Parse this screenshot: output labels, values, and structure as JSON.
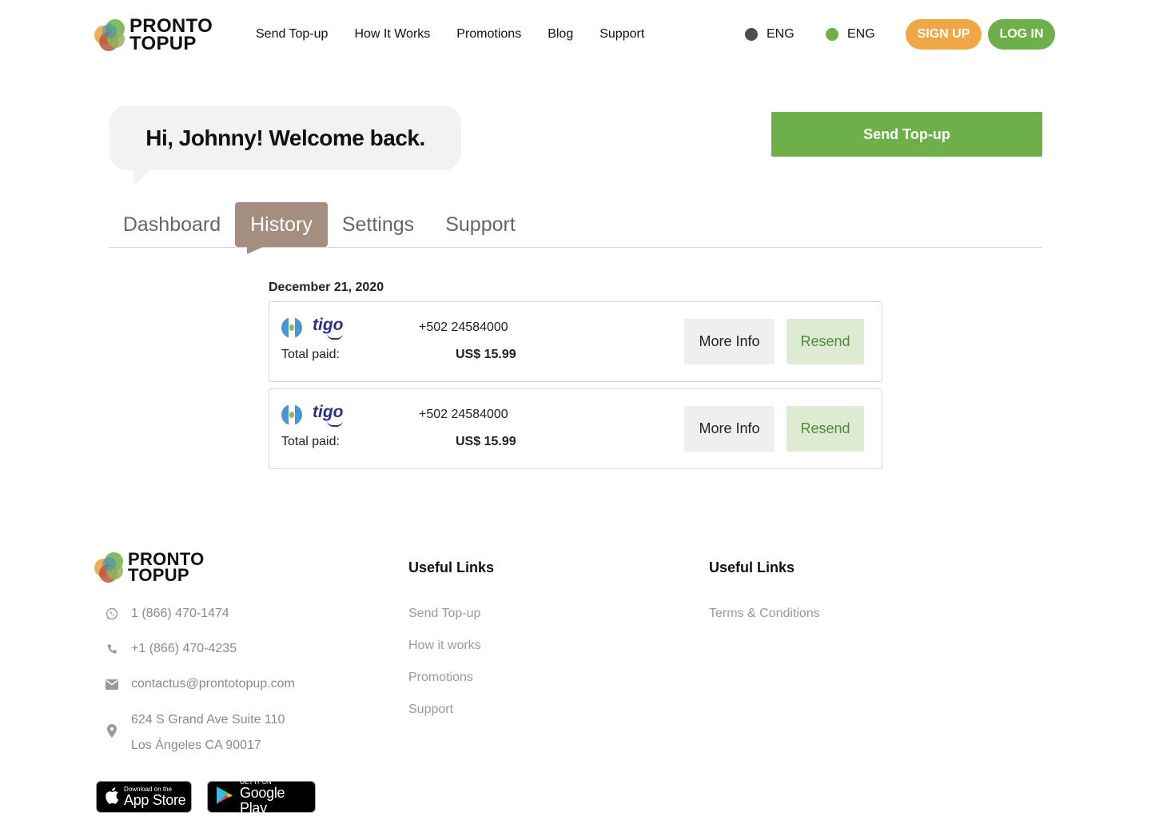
{
  "header": {
    "logo_line1": "PRONTO",
    "logo_line2": "TOPUP",
    "nav": [
      "Send Top-up",
      "How It Works",
      "Promotions",
      "Blog",
      "Support"
    ],
    "languages": [
      {
        "label": "ENG",
        "dot_color": "#4D4D4D"
      },
      {
        "label": "ENG",
        "dot_color": "#6DAF49"
      }
    ],
    "signup_label": "SIGN UP",
    "login_label": "LOG IN"
  },
  "welcome": {
    "greeting": "Hi, Johnny! Welcome back.",
    "send_topup_label": "Send Top-up"
  },
  "tabs": [
    "Dashboard",
    "History",
    "Settings",
    "Support"
  ],
  "active_tab": "History",
  "history": {
    "date": "December 21, 2020",
    "items": [
      {
        "operator": "tigo",
        "phone": "+502 24584000",
        "total_label": "Total paid:",
        "total": "US$ 15.99",
        "more_label": "More Info",
        "resend_label": "Resend"
      },
      {
        "operator": "tigo",
        "phone": "+502 24584000",
        "total_label": "Total paid:",
        "total": "US$ 15.99",
        "more_label": "More Info",
        "resend_label": "Resend"
      }
    ]
  },
  "footer": {
    "logo_line1": "PRONTO",
    "logo_line2": "TOPUP",
    "contacts": {
      "whatsapp": "1 (866) 470-1474",
      "phone": "+1 (866) 470-4235",
      "email": "contactus@prontotopup.com",
      "address_line1": "624 S Grand Ave Suite 110",
      "address_line2": "Los Ángeles CA 90017"
    },
    "col1_title": "Useful Links",
    "col1_links": [
      "Send Top-up",
      "How it works",
      "Promotions",
      "Support"
    ],
    "col2_title": "Useful Links",
    "col2_links": [
      "Terms & Conditions"
    ],
    "app_store": {
      "small": "Download on the",
      "big": "App Store"
    },
    "google_play": {
      "small": "GET IT ON",
      "big": "Google Play"
    }
  },
  "colors": {
    "brand_green": "#6DAF49",
    "brand_orange": "#F0A846",
    "tab_active": "#A38E7F",
    "resend_bg": "#DDEBD3"
  }
}
